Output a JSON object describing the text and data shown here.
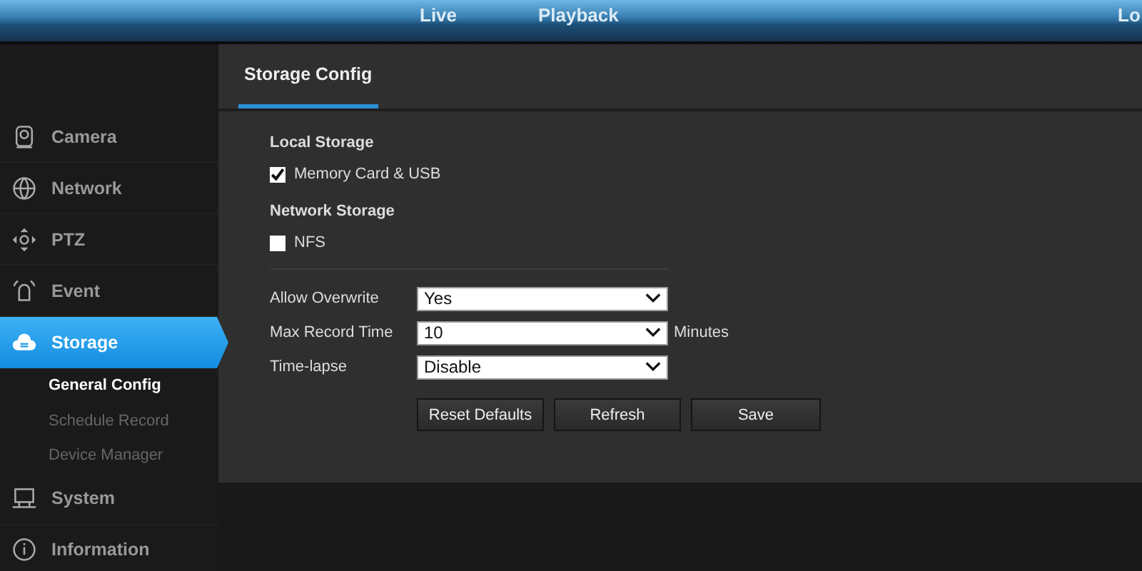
{
  "top_nav": [
    {
      "label": "Live"
    },
    {
      "label": "Playback"
    },
    {
      "label": "Lo"
    }
  ],
  "sidebar": {
    "items": [
      {
        "label": "Camera",
        "selected": false
      },
      {
        "label": "Network",
        "selected": false
      },
      {
        "label": "PTZ",
        "selected": false
      },
      {
        "label": "Event",
        "selected": false
      },
      {
        "label": "Storage",
        "selected": true,
        "children": [
          {
            "label": "General Config",
            "selected": true
          },
          {
            "label": "Schedule Record",
            "selected": false
          },
          {
            "label": "Device Manager",
            "selected": false
          }
        ]
      },
      {
        "label": "System",
        "selected": false
      },
      {
        "label": "Information",
        "selected": false
      }
    ]
  },
  "tab": {
    "label": "Storage Config",
    "selected": true
  },
  "sections": [
    {
      "title": "Local Storage",
      "options": [
        {
          "label": "Memory Card & USB",
          "checked": true
        }
      ]
    },
    {
      "title": "Network Storage",
      "options": [
        {
          "label": "NFS",
          "checked": false
        }
      ]
    }
  ],
  "fields": [
    {
      "label": "Allow Overwrite",
      "value": "Yes"
    },
    {
      "label": "Max Record Time",
      "value": "10",
      "unit": "Minutes"
    },
    {
      "label": "Time-lapse",
      "value": "Disable"
    }
  ],
  "buttons": [
    "Reset Defaults",
    "Refresh",
    "Save"
  ]
}
